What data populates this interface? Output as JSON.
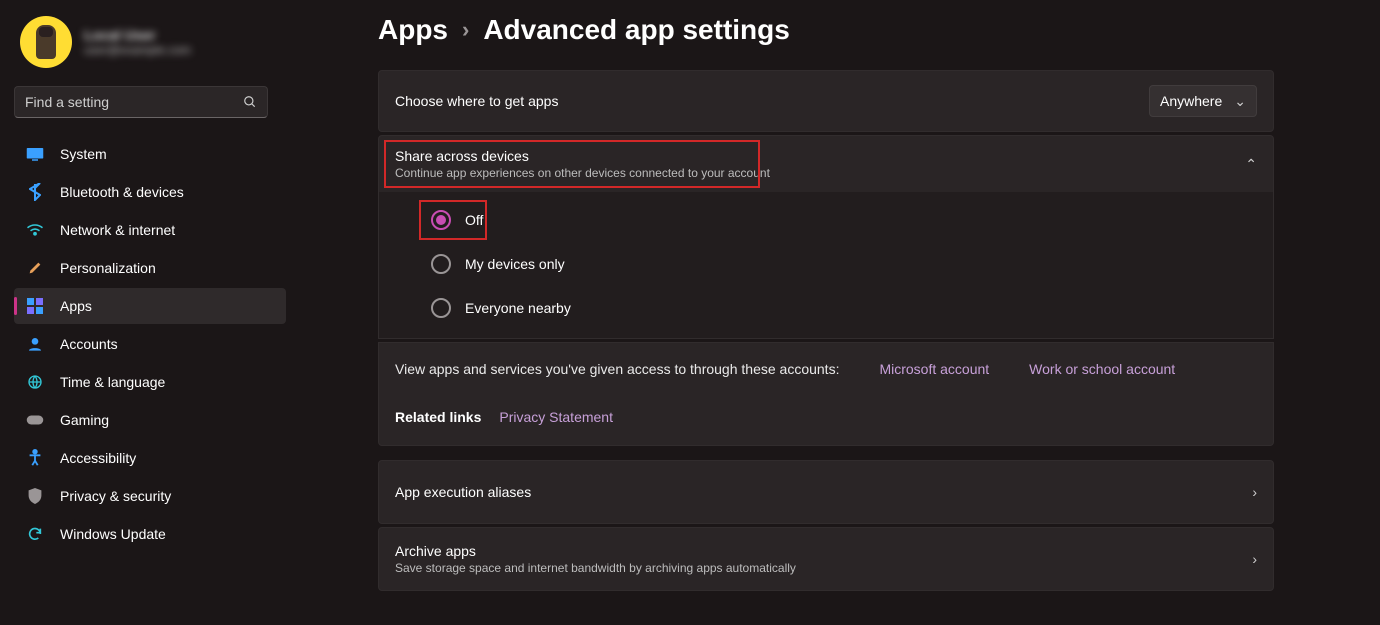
{
  "profile": {
    "name": "Local User",
    "email": "user@example.com"
  },
  "search": {
    "placeholder": "Find a setting"
  },
  "nav": {
    "system": "System",
    "bluetooth": "Bluetooth & devices",
    "network": "Network & internet",
    "personalization": "Personalization",
    "apps": "Apps",
    "accounts": "Accounts",
    "time": "Time & language",
    "gaming": "Gaming",
    "accessibility": "Accessibility",
    "privacy": "Privacy & security",
    "update": "Windows Update"
  },
  "breadcrumb": {
    "root": "Apps",
    "leaf": "Advanced app settings"
  },
  "choose": {
    "label": "Choose where to get apps",
    "value": "Anywhere"
  },
  "share": {
    "title": "Share across devices",
    "subtitle": "Continue app experiences on other devices connected to your account",
    "options": {
      "off": "Off",
      "mine": "My devices only",
      "everyone": "Everyone nearby"
    }
  },
  "access": {
    "label": "View apps and services you've given access to through these accounts:",
    "ms": "Microsoft account",
    "work": "Work or school account"
  },
  "related": {
    "label": "Related links",
    "privacy": "Privacy Statement"
  },
  "aliases": {
    "title": "App execution aliases"
  },
  "archive": {
    "title": "Archive apps",
    "subtitle": "Save storage space and internet bandwidth by archiving apps automatically"
  }
}
